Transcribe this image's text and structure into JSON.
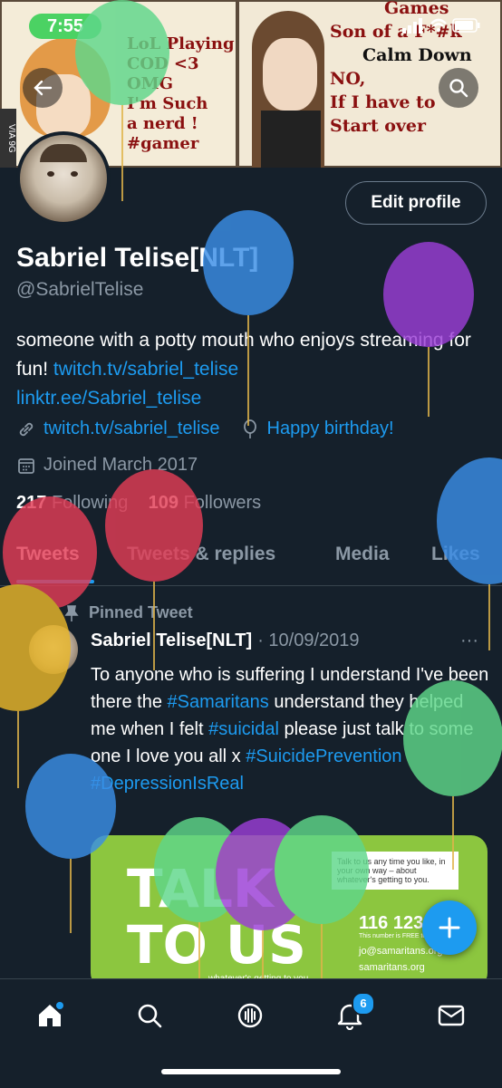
{
  "status_bar": {
    "time": "7:55"
  },
  "banner": {
    "panel_left_text": [
      "LoL Playing",
      "COD <3",
      "OMG",
      "I'm Such",
      "a nerd !",
      "#gamer"
    ],
    "panel_right_text": [
      "Games",
      "Son of a F*#k",
      "Calm Down",
      "NO,",
      "If I have to",
      "Start over"
    ],
    "watermark": "VIA 9G"
  },
  "profile": {
    "edit_label": "Edit profile",
    "name": "Sabriel Telise[NLT]",
    "handle": "@SabrielTelise",
    "bio_text": "someone with a potty mouth who enjoys streaming for fun!",
    "bio_link1": "twitch.tv/sabriel_telise",
    "bio_link2": "linktr.ee/Sabriel_telise",
    "website": "twitch.tv/sabriel_telise",
    "birthday": "Happy birthday!",
    "joined": "Joined March 2017",
    "following_count": "217",
    "following_label": "Following",
    "followers_count": "109",
    "followers_label": "Followers"
  },
  "tabs": [
    "Tweets",
    "Tweets & replies",
    "Media",
    "Likes"
  ],
  "tweet": {
    "pinned_label": "Pinned Tweet",
    "author": "Sabriel Telise[NLT]",
    "date": "· 10/09/2019",
    "text_part1": "To anyone who is suffering I understand I've been there the",
    "hashtag1": "#Samaritans",
    "text_part2": "understand they helped me when I felt",
    "hashtag2": "#suicidal",
    "text_part3": "please just talk to some one I love you all x",
    "hashtag3": "#SuicidePrevention",
    "hashtag4": "#DepressionIsReal",
    "card_title_1": "TALK",
    "card_title_2": "TO US",
    "card_note": "Talk to us any time you like, in your own way – about whatever's getting to you.",
    "card_phone": "116 123",
    "card_phone_note": "This number is FREE to call",
    "card_email": "jo@samaritans.org",
    "card_web": "samaritans.org",
    "card_bottom": "whatever's getting to you"
  },
  "notifications_badge": "6",
  "colors": {
    "background": "#15202b",
    "accent": "#1d9bf0",
    "muted": "#8b98a5",
    "status_green": "#4bd263"
  }
}
